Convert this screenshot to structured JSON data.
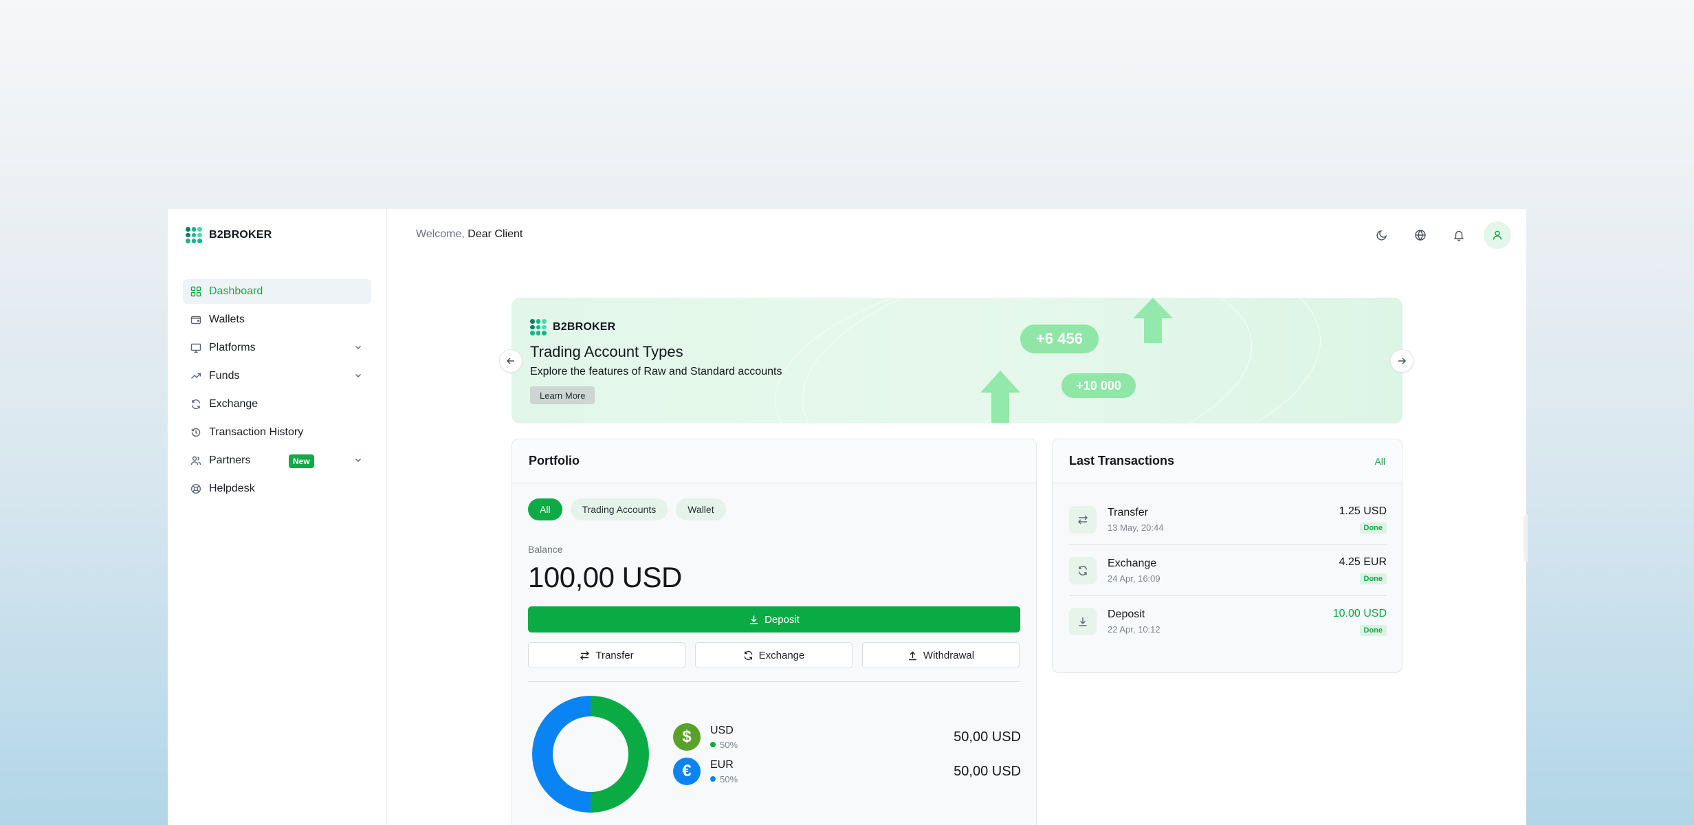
{
  "brand": {
    "name": "B2BROKER",
    "accent": "#0daa45"
  },
  "sidebar": {
    "items": [
      {
        "label": "Dashboard",
        "icon": "dashboard-icon",
        "active": true
      },
      {
        "label": "Wallets",
        "icon": "wallet-icon"
      },
      {
        "label": "Platforms",
        "icon": "monitor-icon",
        "expandable": true
      },
      {
        "label": "Funds",
        "icon": "trending-up-icon",
        "expandable": true
      },
      {
        "label": "Exchange",
        "icon": "refresh-icon"
      },
      {
        "label": "Transaction History",
        "icon": "history-icon"
      },
      {
        "label": "Partners",
        "icon": "users-icon",
        "badge": "New",
        "expandable": true
      },
      {
        "label": "Helpdesk",
        "icon": "lifebuoy-icon"
      }
    ]
  },
  "header": {
    "welcome_prefix": "Welcome,",
    "welcome_name": "Dear Client",
    "icons": [
      "moon-icon",
      "globe-icon",
      "bell-icon",
      "user-icon"
    ]
  },
  "banner": {
    "brand": "B2BROKER",
    "title": "Trading Account Types",
    "subtitle": "Explore the features of Raw and Standard accounts",
    "button": "Learn More",
    "pill_1": "+6 456",
    "pill_2": "+10 000"
  },
  "portfolio": {
    "title": "Portfolio",
    "filters": [
      "All",
      "Trading Accounts",
      "Wallet"
    ],
    "active_filter": "All",
    "balance_label": "Balance",
    "balance_value": "100,00 USD",
    "deposit_label": "Deposit",
    "actions": [
      "Transfer",
      "Exchange",
      "Withdrawal"
    ],
    "assets": [
      {
        "code": "USD",
        "symbol": "$",
        "percent": "50%",
        "share": 0.5,
        "amount": "50,00 USD",
        "color": "#0aab45",
        "coin_color": "#5aa12a"
      },
      {
        "code": "EUR",
        "symbol": "€",
        "percent": "50%",
        "share": 0.5,
        "amount": "50,00 USD",
        "color": "#0b84f3",
        "coin_color": "#0b84f3"
      }
    ]
  },
  "transactions": {
    "title": "Last Transactions",
    "all_link": "All",
    "items": [
      {
        "type": "Transfer",
        "date": "13 May, 20:44",
        "amount": "1.25 USD",
        "status": "Done",
        "icon": "transfer-icon",
        "highlight": false
      },
      {
        "type": "Exchange",
        "date": "24 Apr, 16:09",
        "amount": "4.25 EUR",
        "status": "Done",
        "icon": "exchange-icon",
        "highlight": false
      },
      {
        "type": "Deposit",
        "date": "22 Apr, 10:12",
        "amount": "10.00 USD",
        "status": "Done",
        "icon": "download-icon",
        "highlight": true
      }
    ]
  }
}
